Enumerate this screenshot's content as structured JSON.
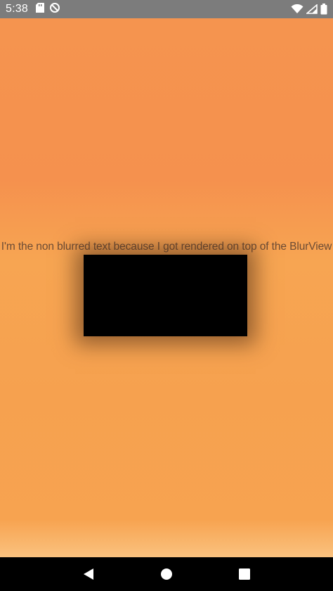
{
  "status_bar": {
    "time": "5:38",
    "left_icons": [
      "sd-card-icon",
      "sync-icon"
    ],
    "right_icons": [
      "wifi-icon",
      "signal-icon",
      "battery-icon"
    ]
  },
  "main": {
    "overlay_text": "I'm the non blurred text because I got rendered on top of the BlurView"
  },
  "nav_bar": {
    "buttons": [
      "back-icon",
      "home-icon",
      "recents-icon"
    ]
  },
  "colors": {
    "status_bar": "#7c7c7c",
    "background": "#f6a050",
    "blur_view": "#000000",
    "nav_bar": "#000000"
  }
}
